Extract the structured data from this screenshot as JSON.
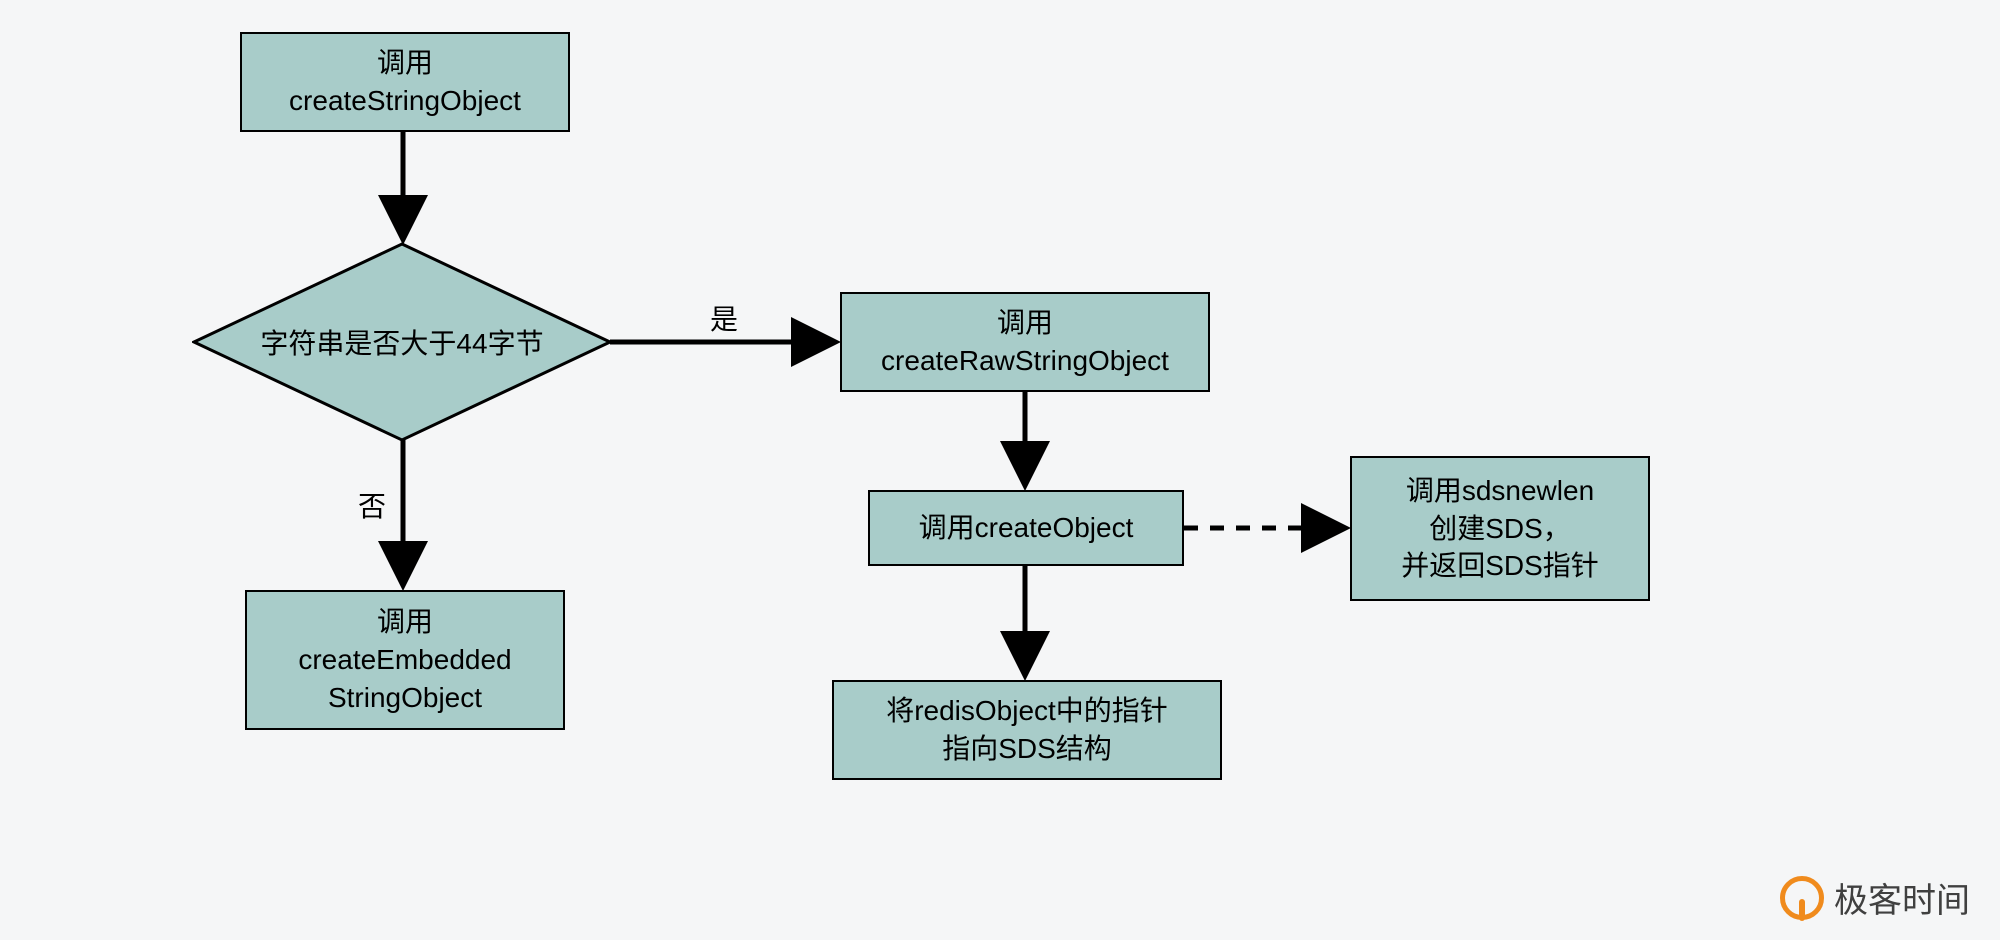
{
  "nodes": {
    "start": {
      "line1": "调用",
      "line2": "createStringObject"
    },
    "decision": {
      "text": "字符串是否大于44字节"
    },
    "embedded": {
      "line1": "调用",
      "line2": "createEmbedded",
      "line3": "StringObject"
    },
    "raw": {
      "line1": "调用",
      "line2": "createRawStringObject"
    },
    "createObj": {
      "text": "调用createObject"
    },
    "sdsnew": {
      "line1": "调用sdsnewlen",
      "line2": "创建SDS，",
      "line3": "并返回SDS指针"
    },
    "pointer": {
      "line1": "将redisObject中的指针",
      "line2": "指向SDS结构"
    }
  },
  "labels": {
    "yes": "是",
    "no": "否"
  },
  "watermark": "极客时间"
}
